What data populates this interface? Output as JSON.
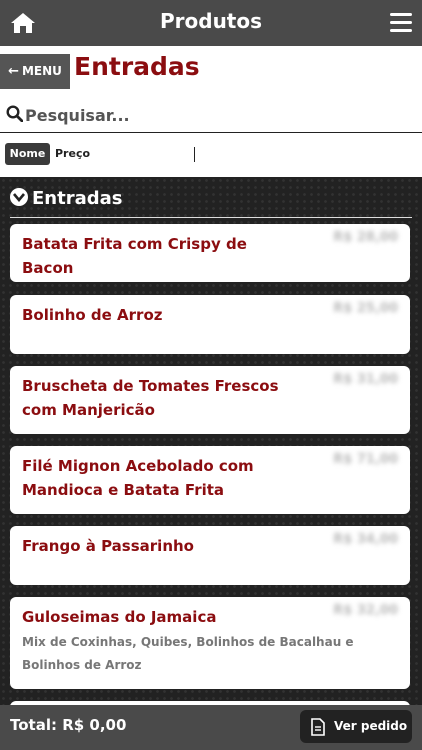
{
  "header": {
    "title": "Produtos"
  },
  "subheader": {
    "back_label": "MENU",
    "section_title": "Entradas"
  },
  "search": {
    "placeholder": "Pesquisar..."
  },
  "sort": {
    "nome_label": "Nome",
    "preco_label": "Preço"
  },
  "category": {
    "label": "Entradas"
  },
  "products": [
    {
      "name": "Batata Frita com Crispy de Bacon",
      "price": "R$ 28,00",
      "desc": ""
    },
    {
      "name": "Bolinho de Arroz",
      "price": "R$ 25,00",
      "desc": ""
    },
    {
      "name": "Bruscheta de Tomates Frescos com Manjericão",
      "price": "R$ 31,00",
      "desc": ""
    },
    {
      "name": "Filé Mignon Acebolado com Mandioca e Batata Frita",
      "price": "R$ 71,00",
      "desc": ""
    },
    {
      "name": "Frango à Passarinho",
      "price": "R$ 34,00",
      "desc": ""
    },
    {
      "name": "Guloseimas do Jamaica",
      "price": "R$ 32,00",
      "desc": "Mix de Coxinhas, Quibes, Bolinhos de Bacalhau e Bolinhos de Arroz"
    }
  ],
  "footer": {
    "total": "Total: R$ 0,00",
    "ver_pedido": "Ver pedido"
  },
  "colors": {
    "brand": "#8b0d10",
    "bar": "#4a4a4a",
    "content_bg": "#222222"
  },
  "icons": [
    "home-icon",
    "hamburger-menu-icon",
    "arrow-left-icon",
    "search-icon",
    "chevron-down-icon",
    "document-icon"
  ]
}
